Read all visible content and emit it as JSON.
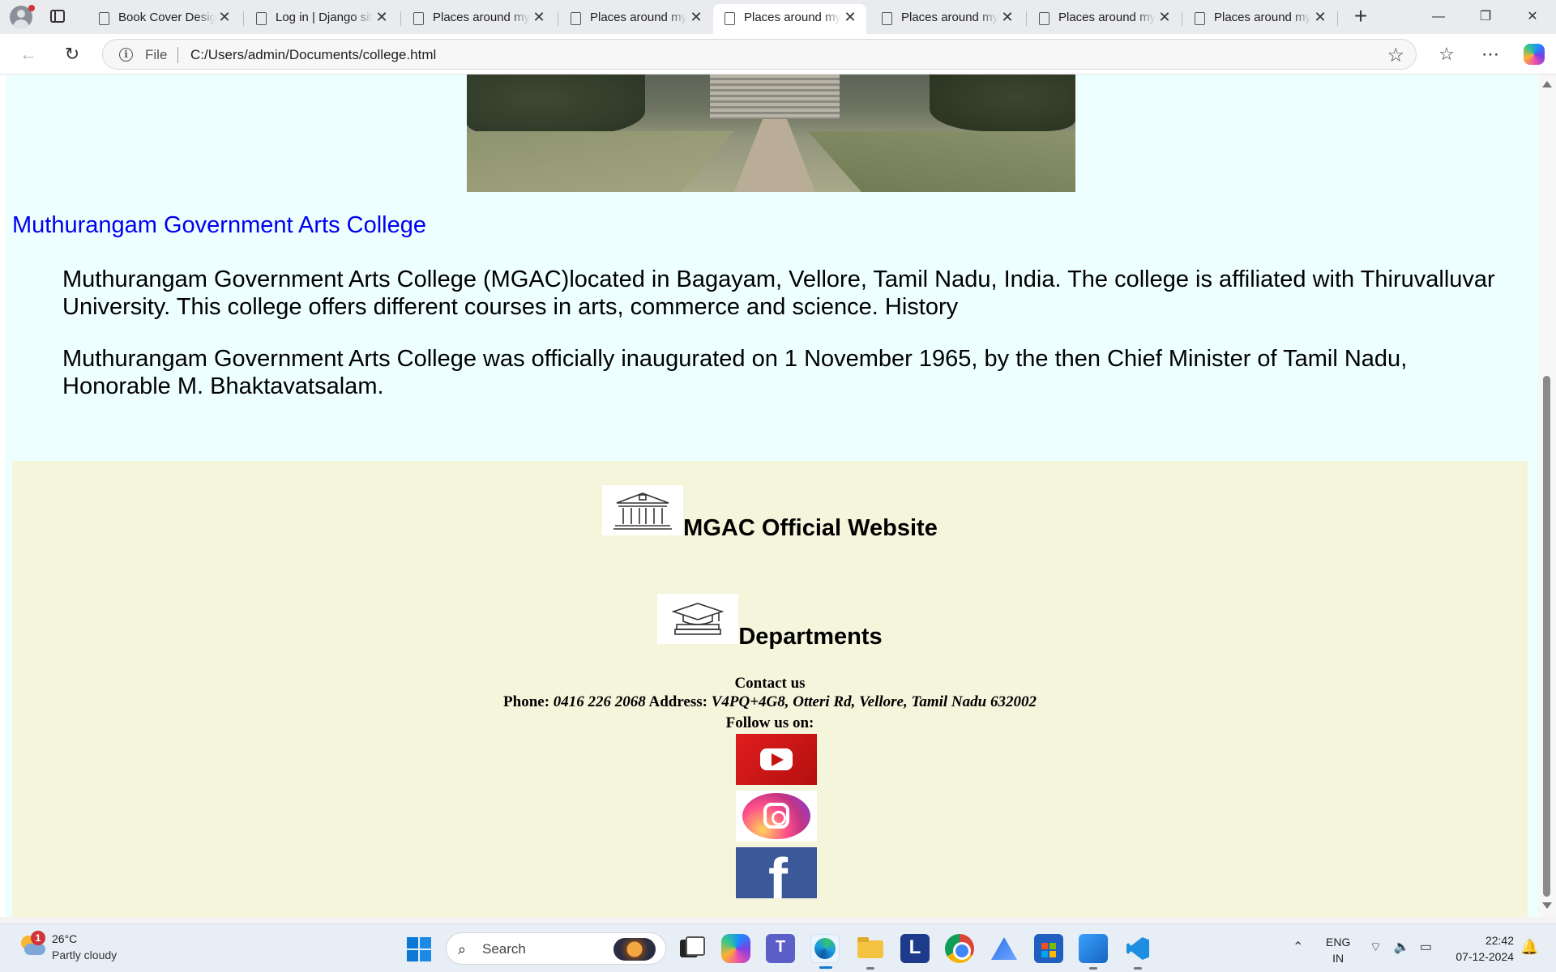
{
  "browser": {
    "tabs": [
      {
        "title": "Book Cover Design",
        "active": false
      },
      {
        "title": "Log in | Django site admin",
        "active": false
      },
      {
        "title": "Places around my",
        "active": false
      },
      {
        "title": "Places around my",
        "active": false
      },
      {
        "title": "Places around my",
        "active": false
      },
      {
        "title": "Places around my",
        "active": false
      },
      {
        "title": "Places around my",
        "active": false
      },
      {
        "title": "Places around my",
        "active": false
      }
    ],
    "active_tab_index": 4,
    "address": {
      "scheme_label": "File",
      "url": "C:/Users/admin/Documents/college.html"
    }
  },
  "page": {
    "college_link": "Muthurangam Government Arts College",
    "paragraphs": [
      "Muthurangam Government Arts College (MGAC)located in Bagayam, Vellore, Tamil Nadu, India. The college is affiliated with Thiruvalluvar University. This college offers different courses in arts, commerce and science. History",
      "Muthurangam Government Arts College was officially inaugurated on 1 November 1965, by the then Chief Minister of Tamil Nadu, Honorable M. Bhaktavatsalam."
    ],
    "footer": {
      "website_heading": "MGAC Official Website",
      "departments_heading": "Departments",
      "contact_title": "Contact us",
      "phone_label": "Phone:",
      "phone": "0416 226 2068",
      "address_label": "Address:",
      "address": "V4PQ+4G8, Otteri Rd, Vellore, Tamil Nadu 632002",
      "follow_label": "Follow us on:",
      "social": [
        "youtube",
        "instagram",
        "facebook"
      ]
    }
  },
  "taskbar": {
    "weather": {
      "badge": "1",
      "temp": "26°C",
      "condition": "Partly cloudy"
    },
    "search_placeholder": "Search",
    "language": {
      "line1": "ENG",
      "line2": "IN"
    },
    "clock": {
      "time": "22:42",
      "date": "07-12-2024"
    }
  },
  "colors": {
    "page_bg": "#eeffff",
    "footer_bg": "#f5f5dc",
    "link": "#0000ee",
    "facebook": "#3b5998",
    "youtube": "#e11d1d"
  }
}
